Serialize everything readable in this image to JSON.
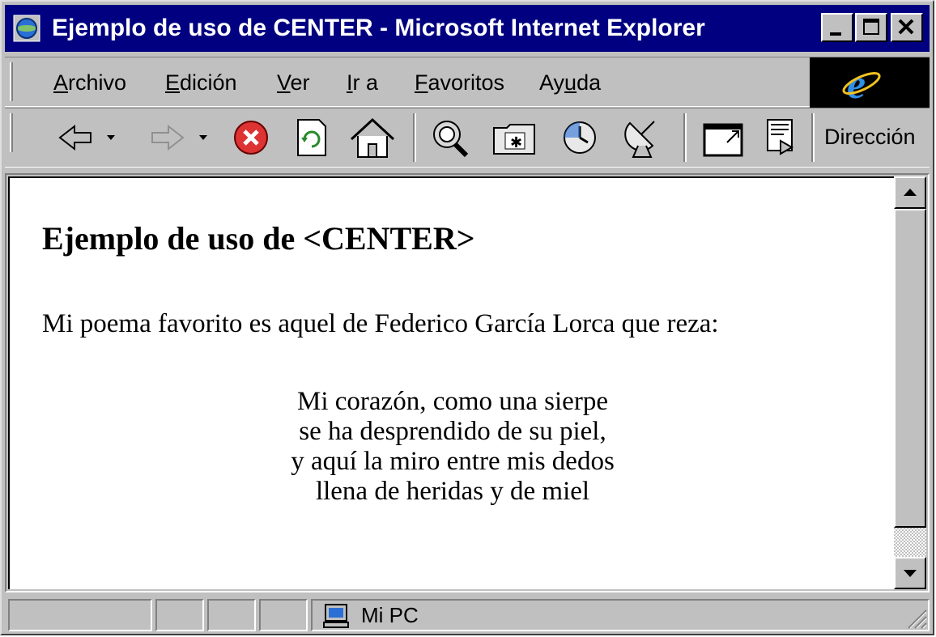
{
  "window": {
    "title": "Ejemplo de uso de CENTER - Microsoft Internet Explorer"
  },
  "menu": {
    "items": [
      {
        "accel": "A",
        "rest": "rchivo"
      },
      {
        "accel": "E",
        "rest": "dición"
      },
      {
        "accel": "V",
        "rest": "er"
      },
      {
        "accel": "I",
        "rest": "r a"
      },
      {
        "accel": "F",
        "rest": "avoritos"
      },
      {
        "pre": "Ay",
        "accel": "u",
        "rest": "da"
      }
    ]
  },
  "toolbar": {
    "address_label": "Dirección"
  },
  "page": {
    "heading_bold": "Ejemplo de uso de ",
    "heading_tag": "<CENTER>",
    "intro": "Mi poema favorito es aquel de Federico García Lorca que reza:",
    "poem": [
      "Mi corazón, como una sierpe",
      "se ha desprendido de su piel,",
      "y aquí la miro entre mis dedos",
      "llena de heridas y de miel"
    ]
  },
  "status": {
    "zone": "Mi PC"
  },
  "colors": {
    "title_bar": "#000080",
    "chrome": "#c0c0c0"
  }
}
